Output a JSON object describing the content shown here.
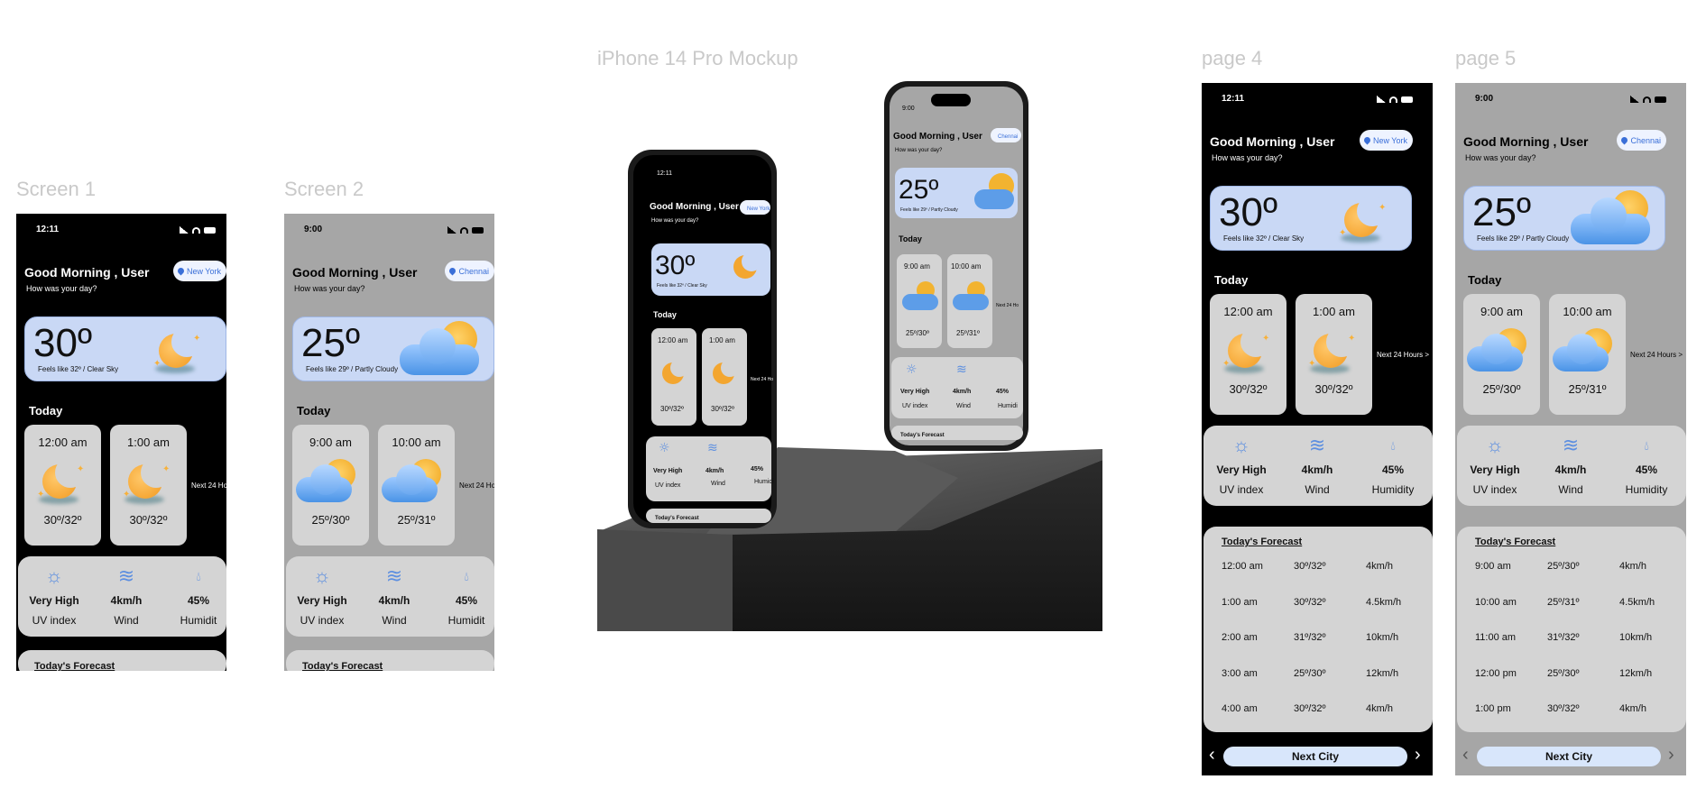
{
  "frames": {
    "screen1_label": "Screen 1",
    "screen2_label": "Screen 2",
    "mockup_label": "iPhone 14 Pro Mockup",
    "page4_label": "page 4",
    "page5_label": "page 5"
  },
  "screens": {
    "s1": {
      "time": "12:11",
      "greeting": "Good Morning , User",
      "sub": "How was your day?",
      "city": "New York",
      "temp": "30º",
      "feels": "Feels like 32º / Clear Sky",
      "today": "Today",
      "hours": [
        {
          "time": "12:00 am",
          "range": "30º/32º"
        },
        {
          "time": "1:00 am",
          "range": "30º/32º"
        }
      ],
      "next24": "Next 24 Ho",
      "stats": [
        {
          "value": "Very High",
          "label": "UV index"
        },
        {
          "value": "4km/h",
          "label": "Wind"
        },
        {
          "value": "45%",
          "label": "Humidit"
        }
      ],
      "forecast_title": "Today's Forecast"
    },
    "s2": {
      "time": "9:00",
      "greeting": "Good Morning , User",
      "sub": "How was your day?",
      "city": "Chennai",
      "temp": "25º",
      "feels": "Feels like 29º / Partly Cloudy",
      "today": "Today",
      "hours": [
        {
          "time": "9:00 am",
          "range": "25º/30º"
        },
        {
          "time": "10:00 am",
          "range": "25º/31º"
        }
      ],
      "next24": "Next 24 Ho",
      "stats": [
        {
          "value": "Very High",
          "label": "UV index"
        },
        {
          "value": "4km/h",
          "label": "Wind"
        },
        {
          "value": "45%",
          "label": "Humidit"
        }
      ],
      "forecast_title": "Today's Forecast"
    },
    "p4": {
      "time": "12:11",
      "greeting": "Good Morning , User",
      "sub": "How was your day?",
      "city": "New York",
      "temp": "30º",
      "feels": "Feels like 32º / Clear Sky",
      "today": "Today",
      "hours": [
        {
          "time": "12:00 am",
          "range": "30º/32º"
        },
        {
          "time": "1:00 am",
          "range": "30º/32º"
        }
      ],
      "next24": "Next 24 Hours >",
      "stats": [
        {
          "value": "Very High",
          "label": "UV index"
        },
        {
          "value": "4km/h",
          "label": "Wind"
        },
        {
          "value": "45%",
          "label": "Humidity"
        }
      ],
      "forecast_title": "Today's Forecast",
      "forecast": [
        {
          "time": "12:00 am",
          "range": "30º/32º",
          "wind": "4km/h"
        },
        {
          "time": "1:00 am",
          "range": "30º/32º",
          "wind": "4.5km/h"
        },
        {
          "time": "2:00 am",
          "range": "31º/32º",
          "wind": "10km/h"
        },
        {
          "time": "3:00 am",
          "range": "25º/30º",
          "wind": "12km/h"
        },
        {
          "time": "4:00 am",
          "range": "30º/32º",
          "wind": "4km/h"
        }
      ],
      "next_city": "Next City"
    },
    "p5": {
      "time": "9:00",
      "greeting": "Good Morning , User",
      "sub": "How was your day?",
      "city": "Chennai",
      "temp": "25º",
      "feels": "Feels like 29º / Partly Cloudy",
      "today": "Today",
      "hours": [
        {
          "time": "9:00 am",
          "range": "25º/30º"
        },
        {
          "time": "10:00 am",
          "range": "25º/31º"
        }
      ],
      "next24": "Next 24 Hours >",
      "stats": [
        {
          "value": "Very High",
          "label": "UV index"
        },
        {
          "value": "4km/h",
          "label": "Wind"
        },
        {
          "value": "45%",
          "label": "Humidity"
        }
      ],
      "forecast_title": "Today's Forecast",
      "forecast": [
        {
          "time": "9:00 am",
          "range": "25º/30º",
          "wind": "4km/h"
        },
        {
          "time": "10:00 am",
          "range": "25º/31º",
          "wind": "4.5km/h"
        },
        {
          "time": "11:00 am",
          "range": "31º/32º",
          "wind": "10km/h"
        },
        {
          "time": "12:00 pm",
          "range": "25º/30º",
          "wind": "12km/h"
        },
        {
          "time": "1:00 pm",
          "range": "30º/32º",
          "wind": "4km/h"
        }
      ],
      "next_city": "Next City"
    }
  },
  "mockup": {
    "front": {
      "time": "12:11",
      "greeting": "Good Morning , User",
      "sub": "How was your day?",
      "city": "New York",
      "temp": "30º",
      "feels": "Feels like 32º / Clear Sky",
      "today": "Today",
      "h1": "12:00 am",
      "r1": "30º/32º",
      "h2": "1:00 am",
      "r2": "30º/32º",
      "next24": "Next 24 Ho",
      "v1": "Very High",
      "l1": "UV index",
      "v2": "4km/h",
      "l2": "Wind",
      "v3": "45%",
      "l3": "Humidi",
      "forecast_title": "Today's Forecast"
    },
    "back": {
      "time": "9:00",
      "greeting": "Good Morning , User",
      "sub": "How was your day?",
      "city": "Chennai",
      "temp": "25º",
      "feels": "Feels like 29º / Partly Cloudy",
      "today": "Today",
      "h1": "9:00 am",
      "r1": "25º/30º",
      "h2": "10:00 am",
      "r2": "25º/31º",
      "next24": "Next 24 Ho",
      "v1": "Very High",
      "l1": "UV index",
      "v2": "4km/h",
      "l2": "Wind",
      "v3": "45%",
      "l3": "Humidi",
      "forecast_title": "Today's Forecast"
    }
  },
  "colors": {
    "accent_blue": "#3a6fd8",
    "hero_bg": "#c9d8f5",
    "card_bg": "#d4d4d4",
    "grey_screen": "#a6a6a6",
    "icons": [
      "location-pin-icon",
      "moon-star-icon",
      "sun-cloud-icon",
      "sun-icon",
      "wind-icon",
      "droplet-icon",
      "chevron-left-icon",
      "chevron-right-icon"
    ]
  }
}
